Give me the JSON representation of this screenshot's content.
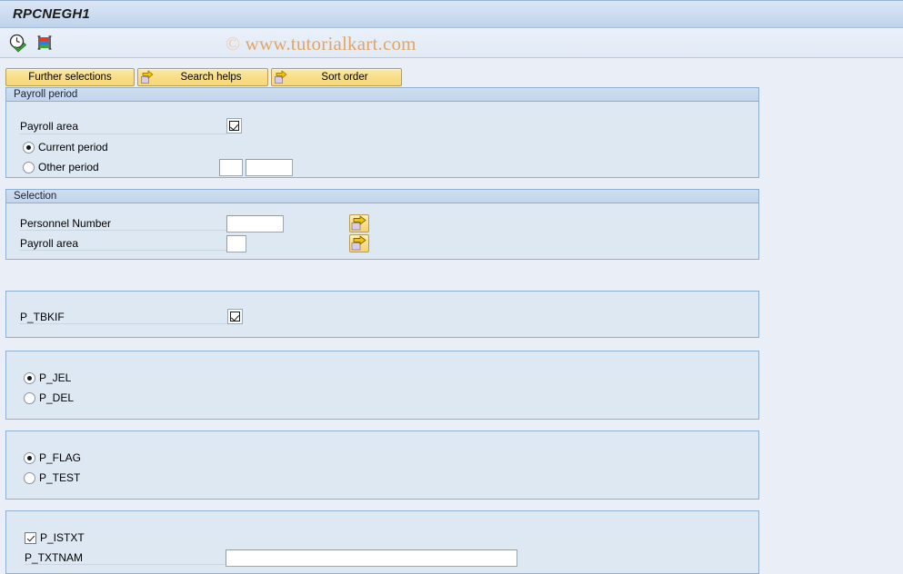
{
  "window": {
    "title": "RPCNEGH1"
  },
  "toolbar": {
    "icons": [
      {
        "name": "execute-clock-icon",
        "tooltip": "Execute"
      },
      {
        "name": "execute-print-icon",
        "tooltip": "Execute and print"
      }
    ],
    "watermark_symbol": "©",
    "watermark_text": "www.tutorialkart.com"
  },
  "buttons": {
    "further_selections": "Further selections",
    "search_helps": "Search helps",
    "sort_order": "Sort order"
  },
  "payroll_period": {
    "header": "Payroll period",
    "payroll_area_label": "Payroll area",
    "payroll_area_checked": true,
    "current_period_label": "Current period",
    "current_period_selected": true,
    "other_period_label": "Other period",
    "other_period_selected": false,
    "other_period_value_1": "",
    "other_period_value_2": ""
  },
  "selection": {
    "header": "Selection",
    "personnel_number_label": "Personnel Number",
    "personnel_number_value": "",
    "payroll_area_label": "Payroll area",
    "payroll_area_value": ""
  },
  "tbkif_block": {
    "label": "P_TBKIF",
    "checked": true
  },
  "jel_block": {
    "options": [
      {
        "label": "P_JEL",
        "selected": true
      },
      {
        "label": "P_DEL",
        "selected": false
      }
    ]
  },
  "flag_block": {
    "options": [
      {
        "label": "P_FLAG",
        "selected": true
      },
      {
        "label": "P_TEST",
        "selected": false
      }
    ]
  },
  "text_block": {
    "istxt_label": "P_ISTXT",
    "istxt_checked": true,
    "txtnam_label": "P_TXTNAM",
    "txtnam_value": ""
  },
  "colors": {
    "page_background": "#eaeff7",
    "panel_background": "#dde8f2",
    "panel_border": "#8fafd1",
    "button_yellow": "#f8dd87",
    "watermark": "#e2a567"
  }
}
